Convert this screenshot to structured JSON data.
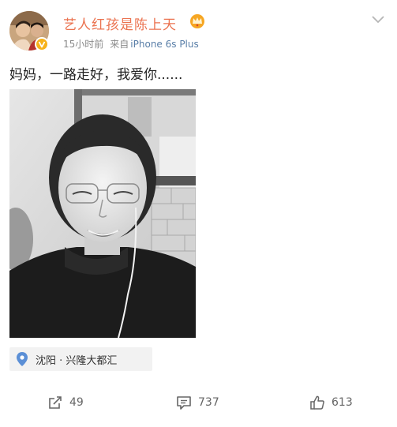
{
  "user": {
    "name": "艺人红孩是陈上天",
    "time": "15小时前",
    "via_prefix": "来自",
    "device": "iPhone 6s Plus"
  },
  "post": {
    "text": "妈妈，一路走好，我爱你......",
    "location": "沈阳 · 兴隆大都汇"
  },
  "actions": {
    "repost_count": "49",
    "comment_count": "737",
    "like_count": "613"
  },
  "colors": {
    "username": "#eb7350",
    "meta": "#8a8a8a",
    "device_link": "#5a7fa8",
    "badge": "#f7b21a",
    "location_pin": "#5b8fd6"
  },
  "icons": [
    "crown-icon",
    "verified-badge-icon",
    "chevron-down-icon",
    "location-pin-icon",
    "repost-icon",
    "comment-icon",
    "like-icon"
  ]
}
